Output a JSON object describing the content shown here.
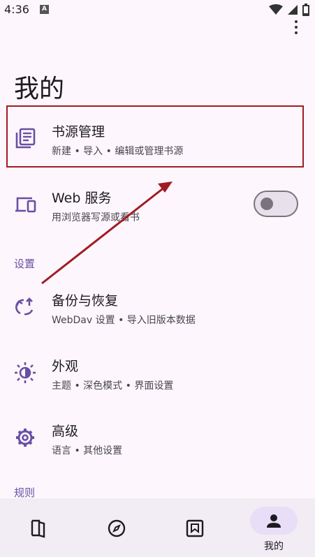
{
  "status_bar": {
    "time": "4:36",
    "notification_glyph": "A"
  },
  "page": {
    "title": "我的"
  },
  "rows": {
    "book_source": {
      "title": "书源管理",
      "subtitle": "新建 • 导入 • 编辑或管理书源",
      "icon": "book-source-icon"
    },
    "web_service": {
      "title": "Web 服务",
      "subtitle": "用浏览器写源或看书",
      "icon": "devices-icon",
      "toggle_on": false
    },
    "backup": {
      "title": "备份与恢复",
      "subtitle": "WebDav 设置 • 导入旧版本数据",
      "icon": "backup-restore-icon"
    },
    "appearance": {
      "title": "外观",
      "subtitle": "主题 • 深色模式 • 界面设置",
      "icon": "theme-icon"
    },
    "advanced": {
      "title": "高级",
      "subtitle": "语言 • 其他设置",
      "icon": "gear-icon"
    }
  },
  "sections": {
    "settings": "设置",
    "rules": "规则"
  },
  "bottom_nav": {
    "items": [
      {
        "name": "bookshelf",
        "icon": "book-icon",
        "label": ""
      },
      {
        "name": "explore",
        "icon": "compass-icon",
        "label": ""
      },
      {
        "name": "rss",
        "icon": "bookmark-box-icon",
        "label": ""
      },
      {
        "name": "mine",
        "icon": "person-icon",
        "label": "我的",
        "selected": true
      }
    ]
  },
  "colors": {
    "accent": "#6750a4",
    "annotation": "#a11b24",
    "background": "#fdf7fd"
  }
}
